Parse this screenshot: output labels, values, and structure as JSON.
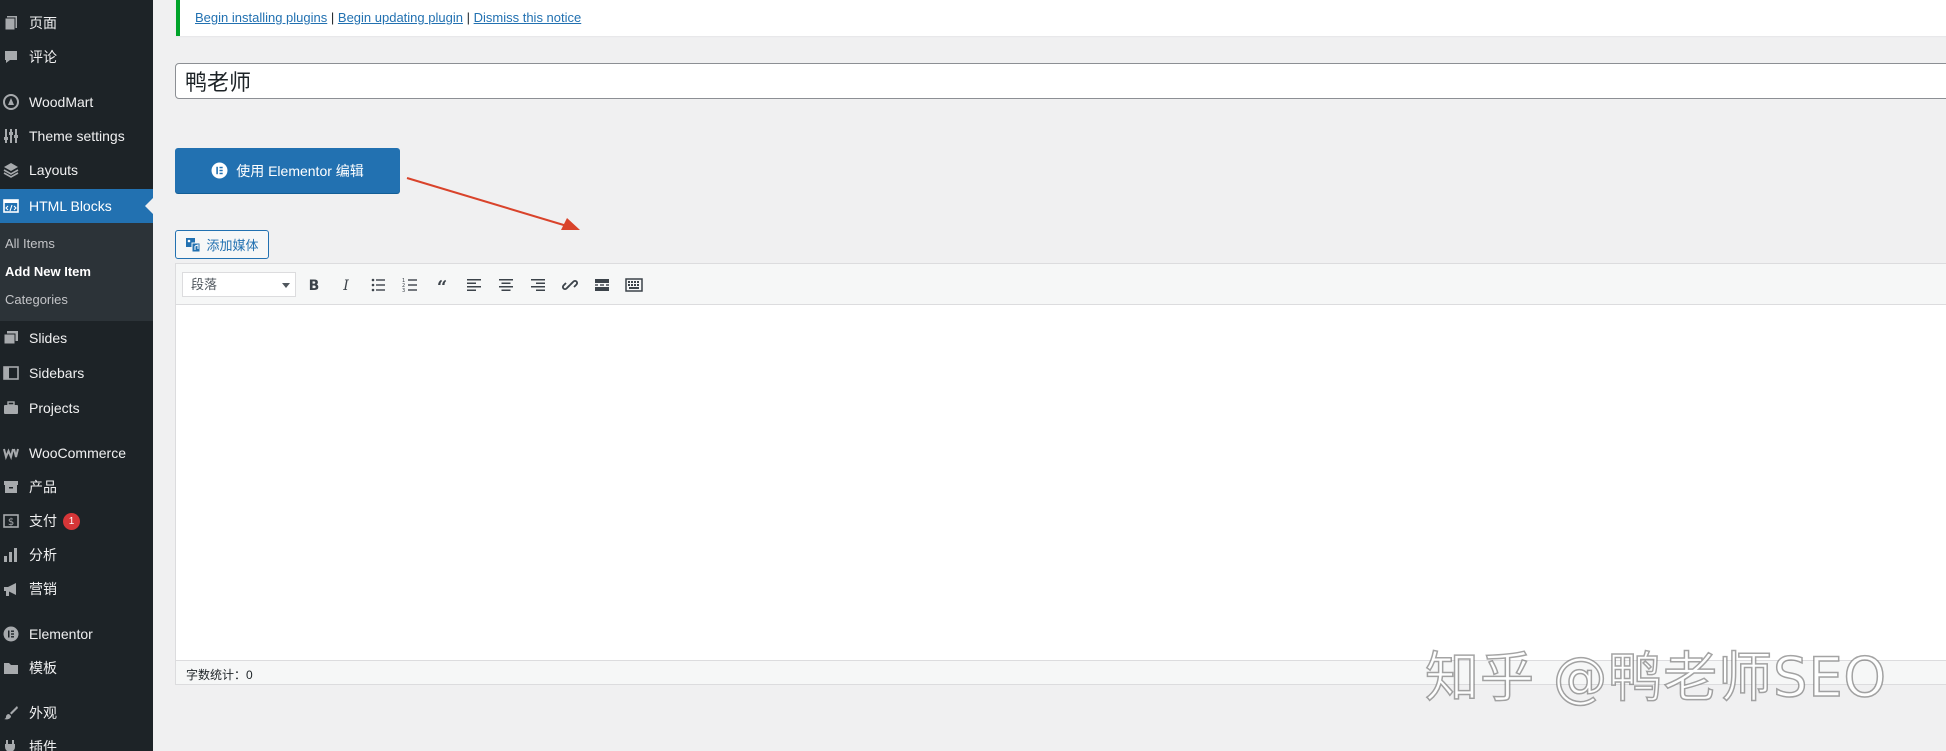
{
  "sidebar": {
    "items": [
      {
        "label": "页面",
        "icon": "page-icon"
      },
      {
        "label": "评论",
        "icon": "comment-icon"
      },
      {
        "label": "WoodMart",
        "icon": "woodmart-icon"
      },
      {
        "label": "Theme settings",
        "icon": "sliders-icon"
      },
      {
        "label": "Layouts",
        "icon": "layers-icon"
      },
      {
        "label": "HTML Blocks",
        "icon": "html-icon"
      },
      {
        "label": "Slides",
        "icon": "slides-icon"
      },
      {
        "label": "Sidebars",
        "icon": "sidebars-icon"
      },
      {
        "label": "Projects",
        "icon": "briefcase-icon"
      },
      {
        "label": "WooCommerce",
        "icon": "woocommerce-icon"
      },
      {
        "label": "产品",
        "icon": "archive-icon"
      },
      {
        "label": "支付",
        "icon": "payment-icon",
        "badge": "1"
      },
      {
        "label": "分析",
        "icon": "chart-bar-icon"
      },
      {
        "label": "营销",
        "icon": "megaphone-icon"
      },
      {
        "label": "Elementor",
        "icon": "elementor-icon"
      },
      {
        "label": "模板",
        "icon": "folder-icon"
      },
      {
        "label": "外观",
        "icon": "brush-icon"
      },
      {
        "label": "插件",
        "icon": "plugin-icon"
      }
    ],
    "submenu": [
      {
        "label": "All Items"
      },
      {
        "label": "Add New Item"
      },
      {
        "label": "Categories"
      }
    ],
    "colors": {
      "background": "#1d2327",
      "current": "#2271b1",
      "badge": "#d63638"
    }
  },
  "notice": {
    "install_link": "Begin installing plugins",
    "separator1": "|",
    "update_link": "Begin updating plugin",
    "separator2": "|",
    "dismiss_link": "Dismiss this notice",
    "border_color": "#00a32a"
  },
  "title": {
    "value": "鸭老师"
  },
  "elementor_button": {
    "label": "使用 Elementor 编辑"
  },
  "add_media": {
    "label": "添加媒体"
  },
  "editor": {
    "format_select": {
      "value": "段落"
    },
    "toolbar_buttons": [
      "bold-icon",
      "italic-icon",
      "bullet-list-icon",
      "numbered-list-icon",
      "blockquote-icon",
      "align-left-icon",
      "align-center-icon",
      "align-right-icon",
      "link-icon",
      "read-more-icon",
      "toolbar-toggle-icon"
    ],
    "word_count": "字数统计：0"
  },
  "watermark": {
    "text": "知乎 @鸭老师SEO"
  },
  "accent_color": "#2271b1"
}
